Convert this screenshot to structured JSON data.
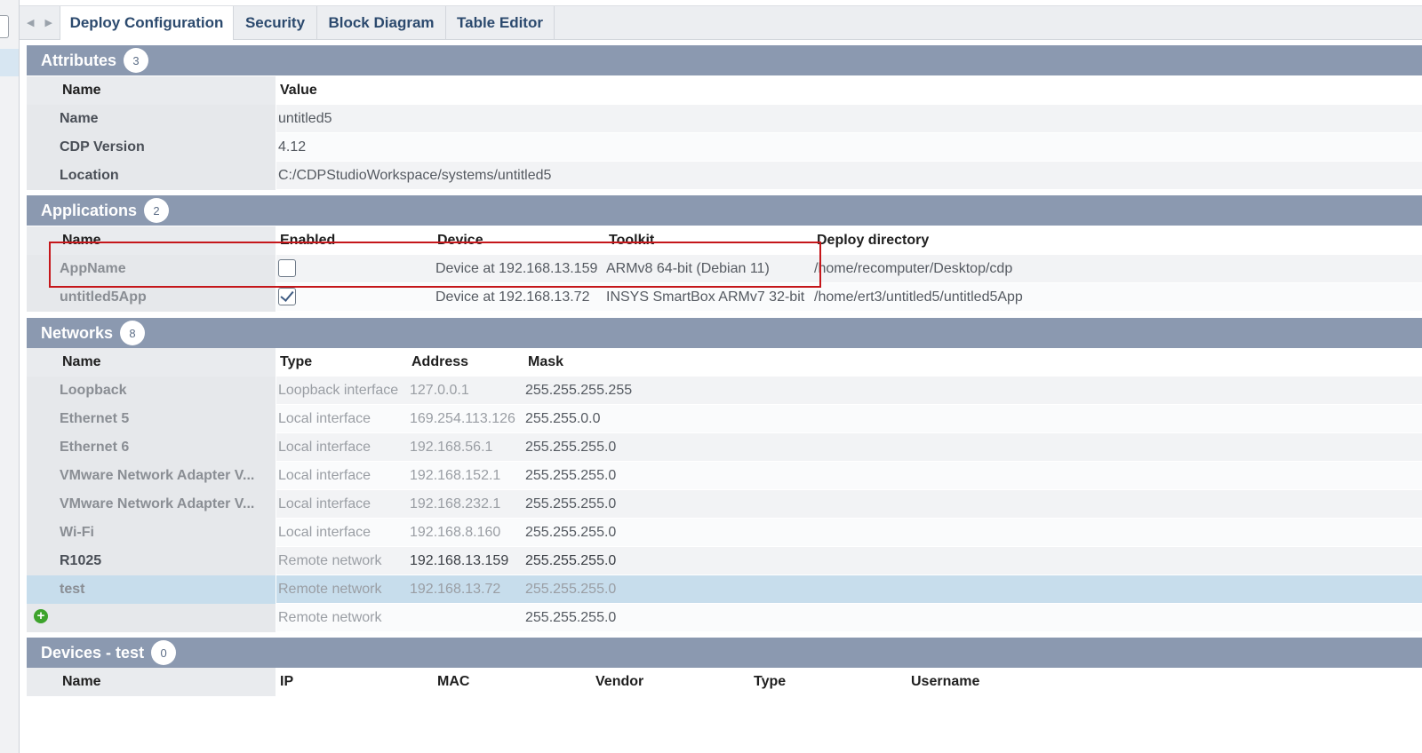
{
  "tabs": [
    {
      "label": "Deploy Configuration",
      "active": true
    },
    {
      "label": "Security"
    },
    {
      "label": "Block Diagram"
    },
    {
      "label": "Table Editor"
    }
  ],
  "attributes": {
    "title": "Attributes",
    "count": "3",
    "columns": [
      "Name",
      "Value"
    ],
    "rows": [
      {
        "name": "Name",
        "value": "untitled5"
      },
      {
        "name": "CDP Version",
        "value": "4.12"
      },
      {
        "name": "Location",
        "value": "C:/CDPStudioWorkspace/systems/untitled5"
      }
    ]
  },
  "applications": {
    "title": "Applications",
    "count": "2",
    "columns": [
      "Name",
      "Enabled",
      "Device",
      "Toolkit",
      "Deploy directory"
    ],
    "rows": [
      {
        "name": "AppName",
        "enabled": false,
        "device": "Device at 192.168.13.159",
        "toolkit": "ARMv8 64-bit (Debian 11)",
        "deploy_dir": "/home/recomputer/Desktop/cdp"
      },
      {
        "name": "untitled5App",
        "enabled": true,
        "device": "Device at 192.168.13.72",
        "toolkit": "INSYS SmartBox ARMv7 32-bit",
        "deploy_dir": "/home/ert3/untitled5/untitled5App"
      }
    ]
  },
  "networks": {
    "title": "Networks",
    "count": "8",
    "columns": [
      "Name",
      "Type",
      "Address",
      "Mask"
    ],
    "rows": [
      {
        "name": "Loopback",
        "type": "Loopback interface",
        "address": "127.0.0.1",
        "mask": "255.255.255.255"
      },
      {
        "name": "Ethernet 5",
        "type": "Local interface",
        "address": "169.254.113.126",
        "mask": "255.255.0.0"
      },
      {
        "name": "Ethernet 6",
        "type": "Local interface",
        "address": "192.168.56.1",
        "mask": "255.255.255.0"
      },
      {
        "name": "VMware Network Adapter V...",
        "type": "Local interface",
        "address": "192.168.152.1",
        "mask": "255.255.255.0"
      },
      {
        "name": "VMware Network Adapter V...",
        "type": "Local interface",
        "address": "192.168.232.1",
        "mask": "255.255.255.0"
      },
      {
        "name": "Wi-Fi",
        "type": "Local interface",
        "address": "192.168.8.160",
        "mask": "255.255.255.0"
      },
      {
        "name": "R1025",
        "type": "Remote network",
        "address": "192.168.13.159",
        "mask": "255.255.255.0"
      },
      {
        "name": "test",
        "type": "Remote network",
        "address": "192.168.13.72",
        "mask": "255.255.255.0",
        "selected": true
      }
    ],
    "new_row": {
      "type": "Remote network",
      "mask": "255.255.255.0"
    }
  },
  "devices": {
    "title": "Devices - test",
    "count": "0",
    "columns": [
      "Name",
      "IP",
      "MAC",
      "Vendor",
      "Type",
      "Username"
    ]
  },
  "icons": {
    "tab_prev": "chevron-left-icon",
    "tab_next": "chevron-right-icon",
    "add": "add-circle-icon",
    "checkbox_checked": "checkmark-icon"
  },
  "colors": {
    "section_header": "#8b99b0",
    "selected_row": "#c7ddec",
    "highlight_box": "#c5161a",
    "add_icon": "#3da32c",
    "tab_text": "#2c4a6e"
  }
}
